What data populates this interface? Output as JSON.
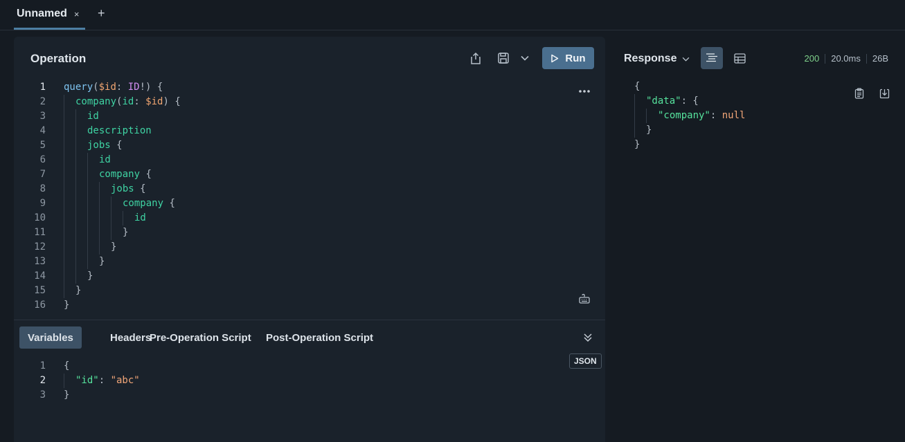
{
  "tabs": {
    "items": [
      {
        "label": "Unnamed",
        "close": "×"
      }
    ],
    "add": "+"
  },
  "operation": {
    "title": "Operation",
    "run_label": "Run",
    "more": "•••",
    "code": [
      {
        "n": "1",
        "active": true,
        "indent": 0,
        "tokens": [
          [
            "kw",
            "query"
          ],
          [
            "punc",
            "("
          ],
          [
            "var",
            "$id"
          ],
          [
            "punc",
            ": "
          ],
          [
            "type",
            "ID"
          ],
          [
            "punc",
            "!) {"
          ]
        ]
      },
      {
        "n": "2",
        "indent": 1,
        "tokens": [
          [
            "field",
            "company"
          ],
          [
            "punc",
            "("
          ],
          [
            "arg",
            "id"
          ],
          [
            "punc",
            ": "
          ],
          [
            "var",
            "$id"
          ],
          [
            "punc",
            ") {"
          ]
        ]
      },
      {
        "n": "3",
        "indent": 2,
        "tokens": [
          [
            "field",
            "id"
          ]
        ]
      },
      {
        "n": "4",
        "indent": 2,
        "tokens": [
          [
            "field",
            "description"
          ]
        ]
      },
      {
        "n": "5",
        "indent": 2,
        "tokens": [
          [
            "field",
            "jobs"
          ],
          [
            "punc",
            " {"
          ]
        ]
      },
      {
        "n": "6",
        "indent": 3,
        "tokens": [
          [
            "field",
            "id"
          ]
        ]
      },
      {
        "n": "7",
        "indent": 3,
        "tokens": [
          [
            "field",
            "company"
          ],
          [
            "punc",
            " {"
          ]
        ]
      },
      {
        "n": "8",
        "indent": 4,
        "tokens": [
          [
            "field",
            "jobs"
          ],
          [
            "punc",
            " {"
          ]
        ]
      },
      {
        "n": "9",
        "indent": 5,
        "tokens": [
          [
            "field",
            "company"
          ],
          [
            "punc",
            " {"
          ]
        ]
      },
      {
        "n": "10",
        "indent": 6,
        "tokens": [
          [
            "field",
            "id"
          ]
        ]
      },
      {
        "n": "11",
        "indent": 5,
        "tokens": [
          [
            "punc",
            "}"
          ]
        ]
      },
      {
        "n": "12",
        "indent": 4,
        "tokens": [
          [
            "punc",
            "}"
          ]
        ]
      },
      {
        "n": "13",
        "indent": 3,
        "tokens": [
          [
            "punc",
            "}"
          ]
        ]
      },
      {
        "n": "14",
        "indent": 2,
        "tokens": [
          [
            "punc",
            "}"
          ]
        ]
      },
      {
        "n": "15",
        "indent": 1,
        "tokens": [
          [
            "punc",
            "}"
          ]
        ]
      },
      {
        "n": "16",
        "indent": 0,
        "tokens": [
          [
            "punc",
            "}"
          ]
        ]
      }
    ]
  },
  "variables": {
    "tabs": [
      {
        "label": "Variables",
        "active": true
      },
      {
        "label": "Headers"
      },
      {
        "label": "Pre-Operation Script"
      },
      {
        "label": "Post-Operation Script"
      }
    ],
    "badge": "JSON",
    "code": [
      {
        "n": "1",
        "indent": 0,
        "tokens": [
          [
            "punc",
            "{"
          ]
        ]
      },
      {
        "n": "2",
        "active": true,
        "indent": 1,
        "tokens": [
          [
            "key",
            "\"id\""
          ],
          [
            "punc",
            ": "
          ],
          [
            "str",
            "\"abc\""
          ]
        ]
      },
      {
        "n": "3",
        "indent": 0,
        "tokens": [
          [
            "punc",
            "}"
          ]
        ]
      }
    ]
  },
  "response": {
    "title": "Response",
    "status": "200",
    "time": "20.0ms",
    "size": "26B",
    "code": [
      {
        "indent": 0,
        "tokens": [
          [
            "punc",
            "{"
          ]
        ]
      },
      {
        "indent": 1,
        "tokens": [
          [
            "key",
            "\"data\""
          ],
          [
            "punc",
            ": {"
          ]
        ]
      },
      {
        "indent": 2,
        "tokens": [
          [
            "key",
            "\"company\""
          ],
          [
            "punc",
            ": "
          ],
          [
            "null",
            "null"
          ]
        ]
      },
      {
        "indent": 1,
        "tokens": [
          [
            "punc",
            "}"
          ]
        ]
      },
      {
        "indent": 0,
        "tokens": [
          [
            "punc",
            "}"
          ]
        ]
      }
    ]
  },
  "icons": {
    "share": "share-icon",
    "save": "save-icon",
    "chevron": "chevron-down-icon",
    "play": "play-icon",
    "more": "more-icon",
    "keyboard": "keyboard-icon",
    "collapse": "collapse-icon",
    "tree_view": "tree-view-icon",
    "table_view": "table-view-icon",
    "copy": "clipboard-icon",
    "download": "download-icon"
  },
  "colors": {
    "accent": "#4a6f8f",
    "status_ok": "#7fd18b",
    "keyword": "#7ec3f0",
    "field": "#3fd3a3",
    "variable": "#f0a571",
    "type": "#d08df0"
  }
}
